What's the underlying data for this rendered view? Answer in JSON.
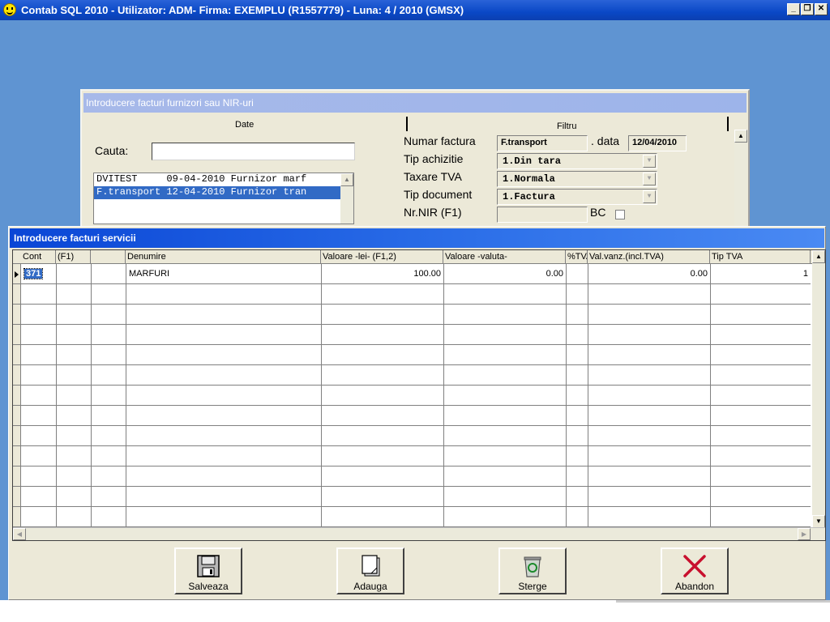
{
  "app": {
    "title": "Contab SQL 2010 - Utilizator: ADM- Firma: EXEMPLU (R1557779) - Luna: 4 / 2010        (GMSX)",
    "min_label": "_",
    "restore_label": "❐",
    "close_label": "✕"
  },
  "nir_window": {
    "title": "Introducere facturi furnizori sau NIR-uri",
    "tab_date": "Date",
    "tab_filtru": "Filtru",
    "search_label": "Cauta:",
    "search_value": "",
    "list": [
      "DVITEST     09-04-2010 Furnizor marf",
      "F.transport 12-04-2010 Furnizor tran"
    ],
    "selected_index": 1,
    "numar_factura_label": "Numar factura",
    "numar_factura_value": "F.transport",
    "data_label": ". data",
    "data_value": "12/04/2010",
    "tip_achizitie_label": "Tip achizitie",
    "tip_achizitie_value": "1.Din tara",
    "taxare_tva_label": "Taxare TVA",
    "taxare_tva_value": "1.Normala",
    "tip_document_label": "Tip document",
    "tip_document_value": "1.Factura",
    "nr_nir_label": "Nr.NIR (F1)",
    "nr_nir_value": "",
    "bc_label": "BC"
  },
  "svc_window": {
    "title": "Introducere facturi servicii",
    "columns": [
      "Cont",
      "(F1)",
      "",
      "Denumire",
      "Valoare -lei- (F1,2)",
      "Valoare -valuta-",
      "%TVA",
      "Val.vanz.(incl.TVA)",
      "Tip TVA"
    ],
    "rows": [
      [
        "371",
        "",
        "",
        "MARFURI",
        "100.00",
        "0.00",
        "",
        "0.00",
        "1"
      ]
    ],
    "buttons": {
      "save": "Salveaza",
      "add": "Adauga",
      "delete": "Sterge",
      "abandon": "Abandon"
    }
  }
}
